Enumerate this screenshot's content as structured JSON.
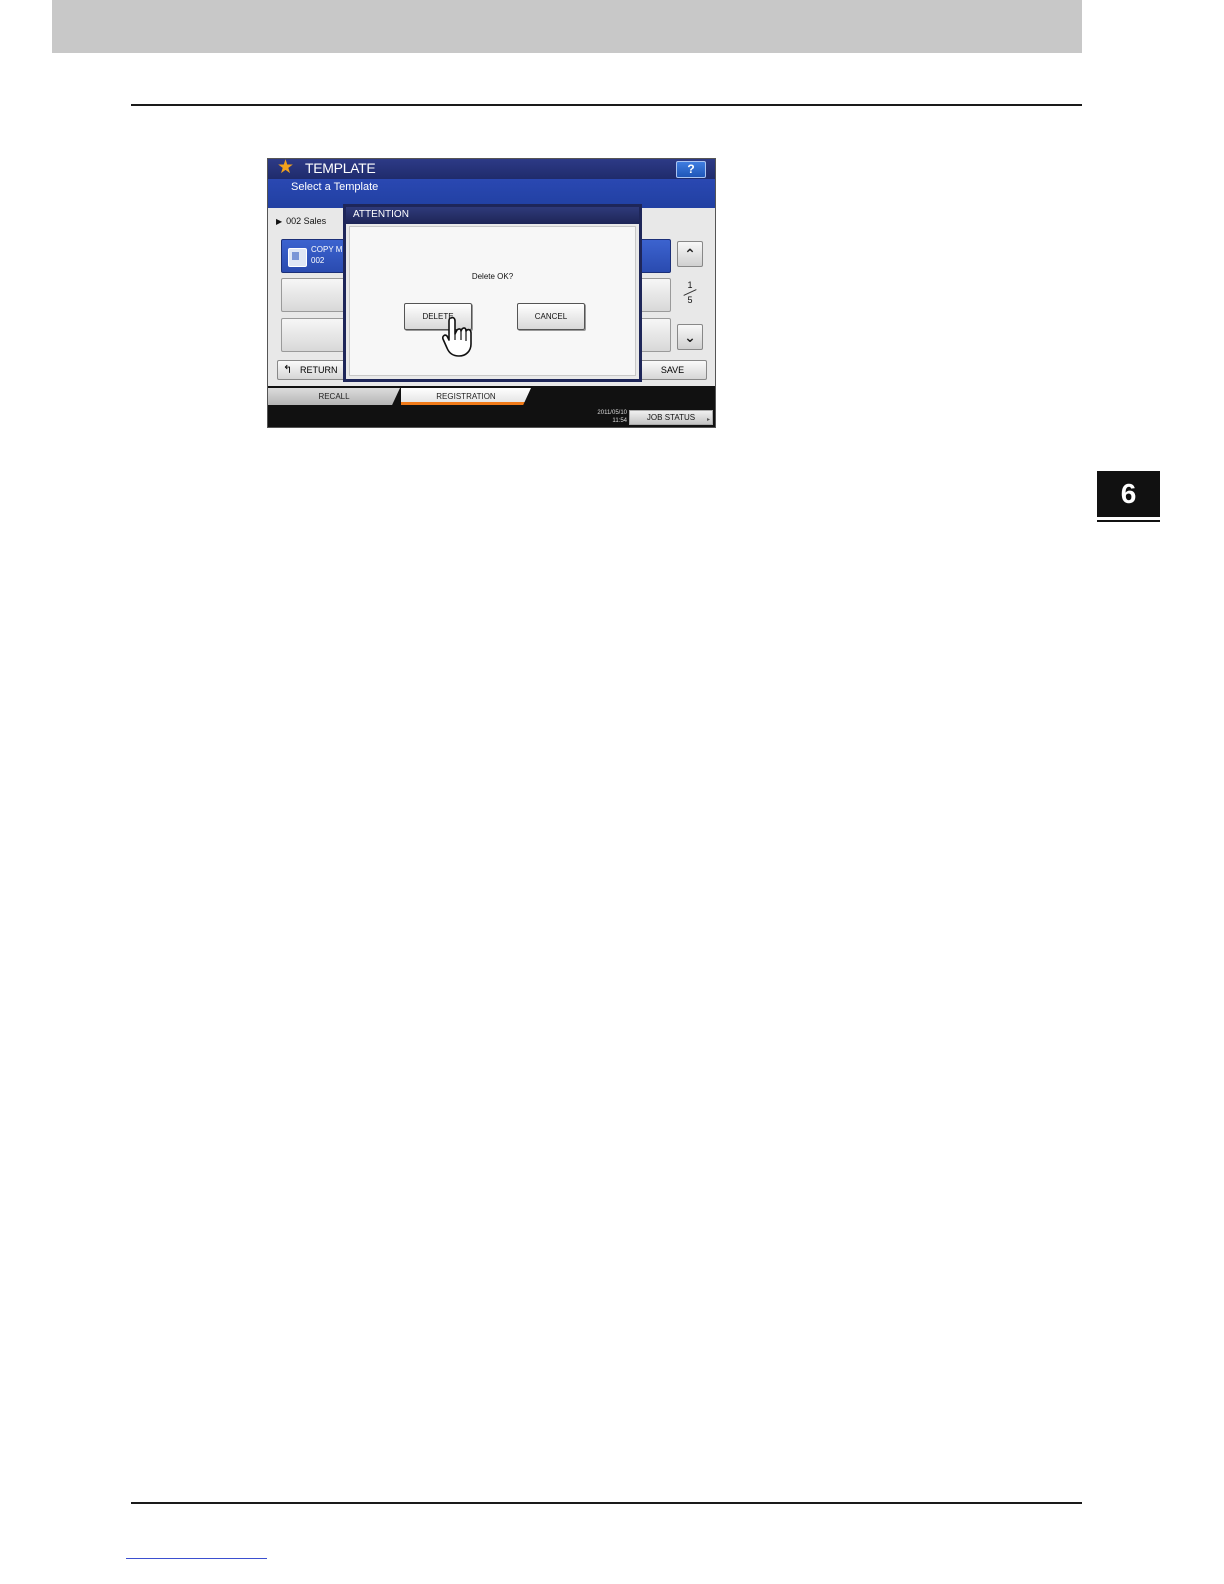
{
  "page": {
    "chapter_number": "6"
  },
  "screen": {
    "title": "TEMPLATE",
    "subtitle": "Select a Template",
    "help_label": "?",
    "breadcrumb": "002 Sales",
    "templates": [
      {
        "name_line1": "COPY M",
        "name_line2": "002",
        "selected": true
      },
      {
        "name_line1": "",
        "name_line2": "",
        "selected": false
      },
      {
        "name_line1": "",
        "name_line2": "",
        "selected": false
      }
    ],
    "scroll_up_icon": "chevron-up-icon",
    "scroll_down_icon": "chevron-down-icon",
    "page_current": "1",
    "page_total": "5",
    "return_label": "RETURN",
    "save_label": "SAVE",
    "tabs": [
      {
        "label": "RECALL",
        "active": false
      },
      {
        "label": "REGISTRATION",
        "active": true
      }
    ],
    "clock_date": "2011/05/10",
    "clock_time": "11:54",
    "job_status_label": "JOB STATUS",
    "colors": {
      "title_bar": "#1f2b6c",
      "subtitle_bar": "#2140a2",
      "accent_tab": "#f07a19",
      "star": "#f2a21c"
    }
  },
  "dialog": {
    "title": "ATTENTION",
    "message": "Delete OK?",
    "delete_label": "DELETE",
    "cancel_label": "CANCEL"
  }
}
